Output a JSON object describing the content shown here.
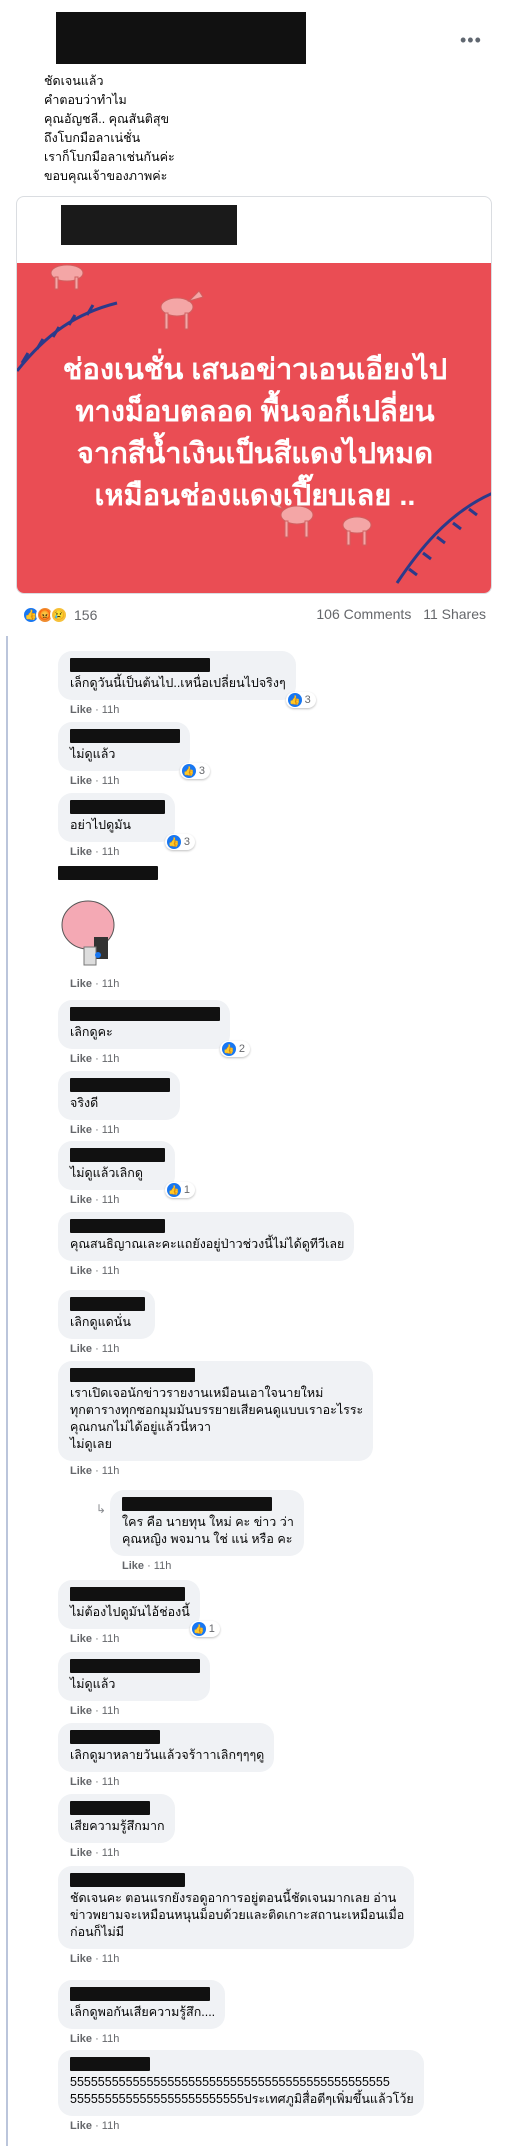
{
  "post": {
    "more_label": "•••",
    "lines": [
      "ชัดเจนแล้ว",
      "คำตอบว่าทำไม",
      "คุณอัญชลี.. คุณสันติสุข",
      "ถึงโบกมือลาเน่ชั่น",
      "เราก็โบกมือลาเช่นกันค่ะ",
      "ขอบคุณเจ้าของภาพค่ะ"
    ]
  },
  "shared": {
    "banner_lines": [
      "ช่องเนชั่น เสนอข่าวเอนเอียงไป",
      "ทางม็อบตลอด พื้นจอก็เปลี่ยน",
      "จากสีน้ำเงินเป็นสีแดงไปหมด",
      "เหมือนช่องแดงเปี๊ยบเลย .."
    ],
    "banner_color": "#ea4d54"
  },
  "reactions": {
    "count": "156",
    "comments": "106 Comments",
    "shares": "11 Shares"
  },
  "meta": {
    "like": "Like",
    "dot": " · ",
    "time": "11h"
  },
  "comments": [
    {
      "text": "เล็กดูวันนี้เป็นต้นไป..เหนื่อเปลี่ยนไปจริงๆ",
      "react": "3"
    },
    {
      "text": "ไม่ดูแล้ว",
      "react": "3"
    },
    {
      "text": "อย่าไปดูมัน",
      "react": "3"
    },
    {
      "text": "",
      "react": ""
    },
    {
      "text": "เลิกดูคะ",
      "react": "2"
    },
    {
      "text": "จริงดี",
      "react": ""
    },
    {
      "text": "ไม่ดูแล้วเลิกดู",
      "react": "1"
    },
    {
      "text": "คุณสนธิญาณเละคะแถยังอยู่ป่าวช่วงนี้ไม่ได้ดูทีวีเลย",
      "react": ""
    },
    {
      "text": "เลิกดูแดนั่น",
      "react": ""
    },
    {
      "lines": [
        "เราเปิดเจอนักข่าวรายงานเหมือนเอาใจนายใหม่",
        "ทุกตารางทุกซอกมุมมันบรรยายเสียคนดูแบบเราอะไรระ",
        "คุณกนกไม่ได้อยู่แล้วนี่หวา",
        "ไม่ดูเลย"
      ],
      "react": ""
    },
    {
      "lines": [
        "ใคร คือ นายทุน ใหม่ คะ ข่าว ว่า",
        "คุณหญิง พจมาน ใช่ แน่ หรือ คะ"
      ],
      "react": ""
    },
    {
      "text": "ไม่ต้องไปดูมันไอ้ช่องนี้",
      "react": "1"
    },
    {
      "text": "ไม่ดูแล้ว",
      "react": ""
    },
    {
      "text": "เลิกดูมาหลายวันแล้วจร้าาาเลิกๆๆๆดู",
      "react": ""
    },
    {
      "text": "เสียความรู้สึกมาก",
      "react": ""
    },
    {
      "lines": [
        "ชัดเจนคะ ตอนแรกยังรอดูอาการอยู่ตอนนี้ชัดเจนมากเลย อ่าน",
        "ข่าวพยามจะเหมือนหนุนม็อบด้วยและติดเกาะสถานะเหมือนเมื่อ",
        "ก่อนก็ไม่มี"
      ],
      "react": ""
    },
    {
      "text": "เล็กดูพอกันเสียความรู้สึก....",
      "react": ""
    },
    {
      "lines": [
        "5555555555555555555555555555555555555555555555",
        "5555555555555555555555555ประเทศภูมิสื่อตีๆเพิ่มขึ้นแล้วโว้ย"
      ],
      "react": ""
    }
  ]
}
